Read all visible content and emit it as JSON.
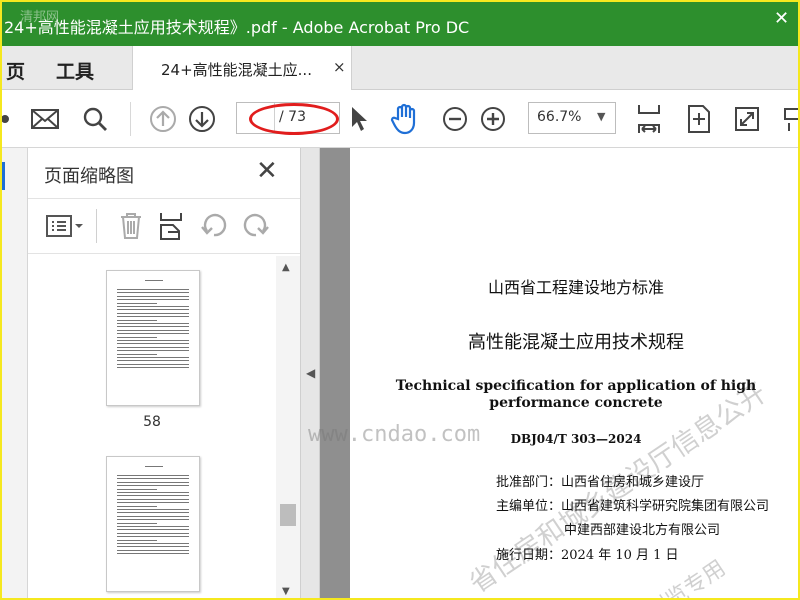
{
  "window": {
    "title": "24+高性能混凝土应用技术规程》.pdf - Adobe Acrobat Pro DC",
    "watermark": "清邦网",
    "controls": {
      "close": "✕"
    }
  },
  "menu_tabs": [
    {
      "label": "页"
    },
    {
      "label": "工具"
    }
  ],
  "doc_tab": {
    "label": "24+高性能混凝土应...",
    "close": "×"
  },
  "toolbar": {
    "page_total": "/ 73",
    "page_current": "",
    "zoom": "66.7%",
    "icons": [
      "mail-icon",
      "search-icon",
      "prev-page-icon",
      "next-page-icon",
      "select-cursor-icon",
      "hand-tool-icon",
      "zoom-out-icon",
      "zoom-in-icon",
      "fit-width-icon",
      "fit-page-icon",
      "fullscreen-icon",
      "more-icon"
    ]
  },
  "thumbnail_pane": {
    "title": "页面缩略图",
    "close": "✕",
    "pages": [
      {
        "number": "58"
      },
      {
        "number": ""
      }
    ]
  },
  "document": {
    "standard_title": "山西省工程建设地方标准",
    "title_cn": "高性能混凝土应用技术规程",
    "title_en": "Technical specification for application of high performance concrete",
    "code": "DBJ04/T 303—2024",
    "approver": "批准部门：山西省住房和城乡建设厅",
    "editor_1": "主编单位：山西省建筑科学研究院集团有限公司",
    "editor_2": "中建西部建设北方有限公司",
    "date": "施行日期：2024 年 10 月 1 日",
    "watermarks": [
      "省住房和城乡建设厅信息公开",
      "浏览专用"
    ],
    "site_watermark": "www.cndao.com"
  },
  "colors": {
    "titlebar": "#2d8f2d",
    "frame": "#f5e81f",
    "annotation": "#e11d1d",
    "doc_bg": "#8f8f8f"
  }
}
